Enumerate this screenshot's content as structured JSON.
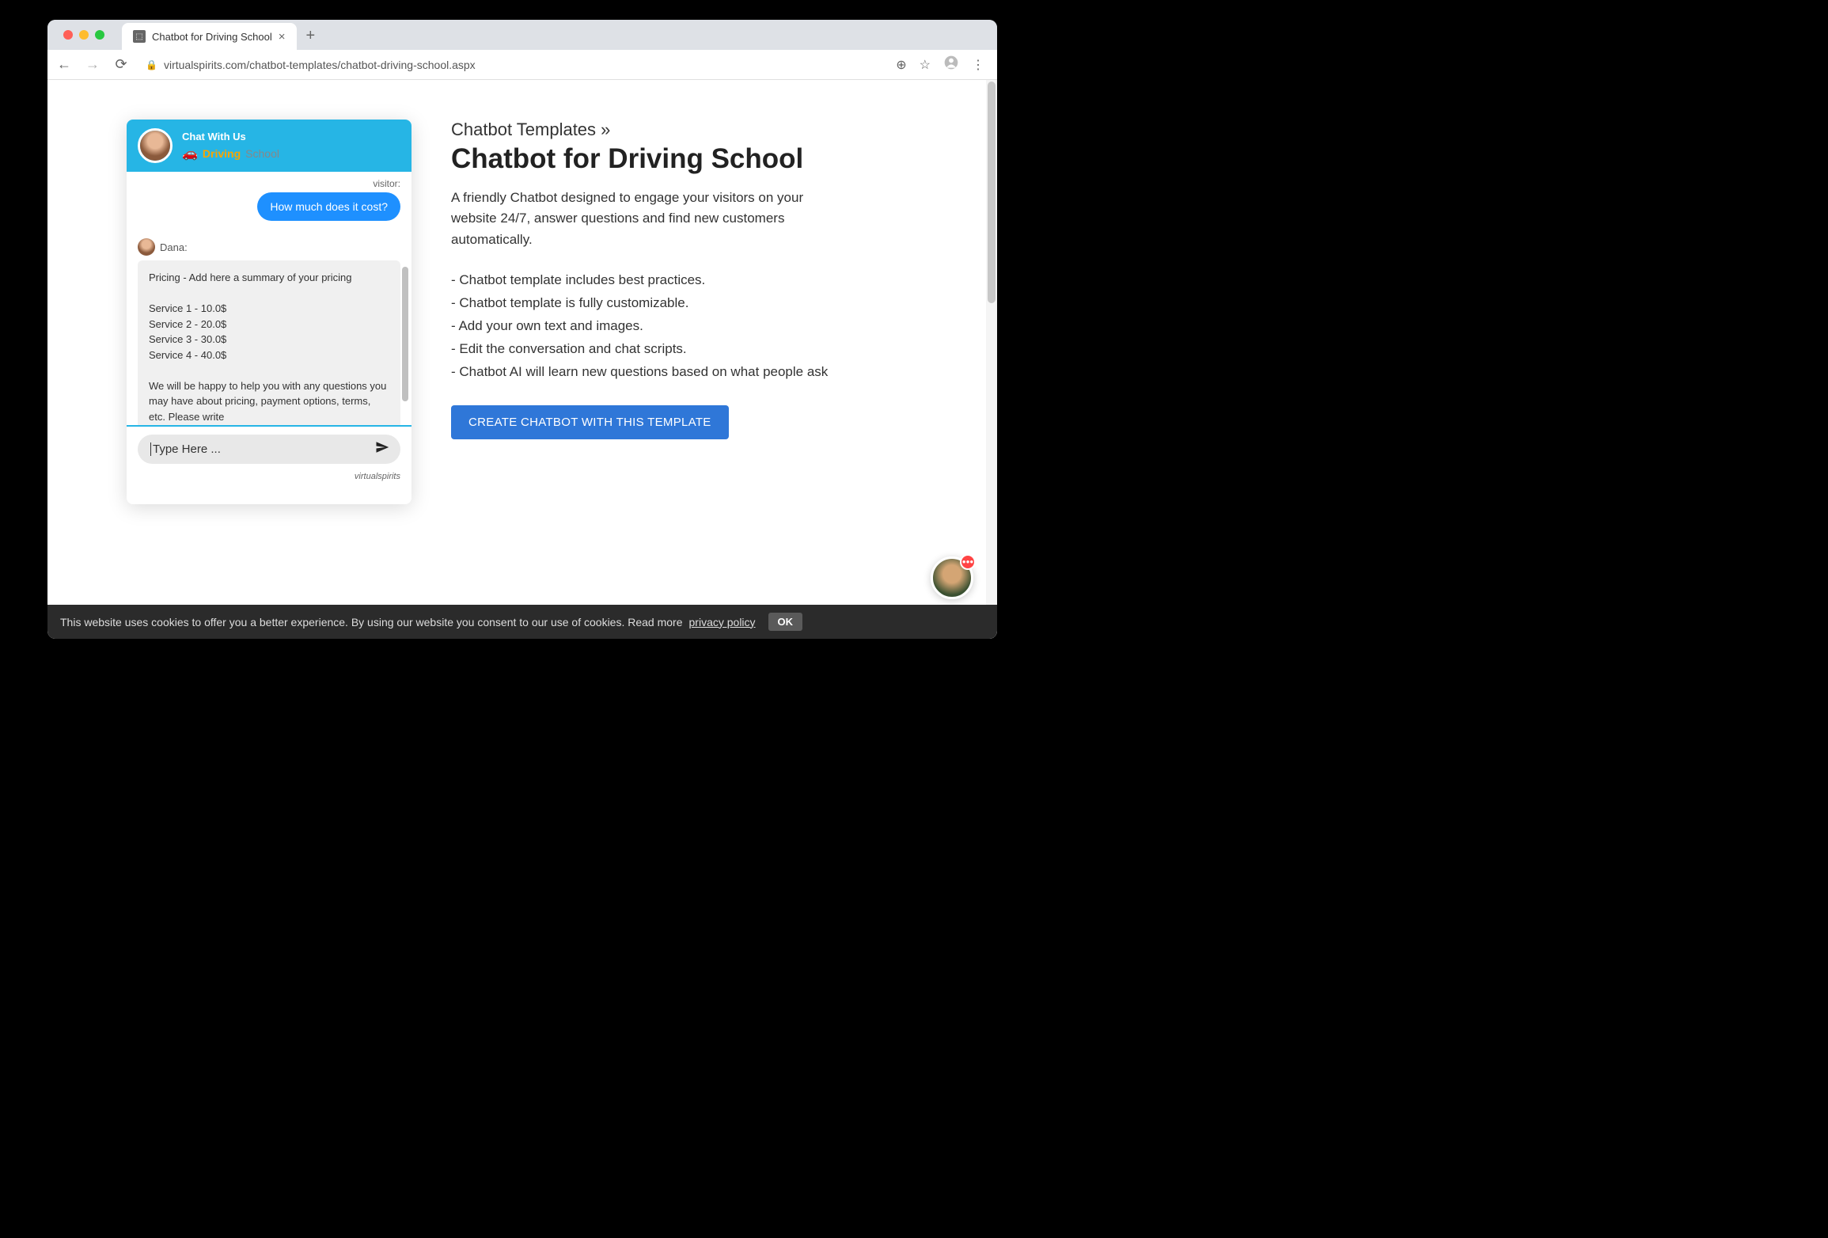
{
  "browser": {
    "tab_title": "Chatbot for Driving School",
    "url": "virtualspirits.com/chatbot-templates/chatbot-driving-school.aspx"
  },
  "chat": {
    "header_label": "Chat With Us",
    "brand_driving": "Driving",
    "brand_school": "School",
    "visitor_label": "visitor:",
    "visitor_message": "How much does it cost?",
    "agent_name": "Dana:",
    "agent_message": "Pricing - Add here a summary of your pricing\n\nService 1 - 10.0$\nService 2 - 20.0$\nService 3 - 30.0$\nService 4 - 40.0$\n\nWe will be happy to help you with any questions you may have about pricing, payment options, terms, etc. Please write",
    "input_placeholder": "Type Here ...",
    "footer_text": "virtualspirits"
  },
  "page": {
    "breadcrumb": "Chatbot Templates »",
    "title": "Chatbot for Driving School",
    "description": "A friendly Chatbot designed to engage your visitors on your website 24/7, answer questions and find new customers automatically.",
    "features": [
      "- Chatbot template includes best practices.",
      "- Chatbot template is fully customizable.",
      "- Add your own text and images.",
      "- Edit the conversation and chat scripts.",
      "- Chatbot AI will learn new questions based on what people ask"
    ],
    "cta_label": "CREATE CHATBOT WITH THIS TEMPLATE"
  },
  "cookie": {
    "text": "This website uses cookies to offer you a better experience. By using our website you consent to our use of cookies. Read more ",
    "link_text": "privacy policy",
    "ok_label": "OK"
  }
}
